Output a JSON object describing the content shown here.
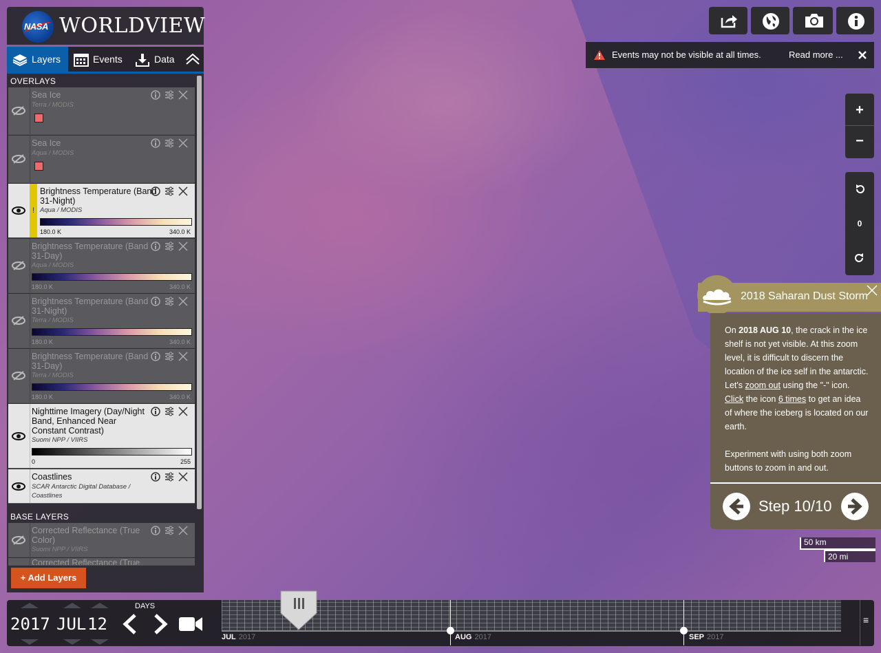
{
  "app": {
    "nasa": "NASA",
    "title": "WORLDVIEW"
  },
  "tabs": [
    {
      "label": "Layers",
      "icon": "layers-icon"
    },
    {
      "label": "Events",
      "icon": "calendar-icon"
    },
    {
      "label": "Data",
      "icon": "download-icon"
    }
  ],
  "sections": {
    "overlays": "OVERLAYS",
    "base_layers": "BASE LAYERS"
  },
  "layers": [
    {
      "name": "Sea Ice",
      "source": "Terra / MODIS",
      "visible": false,
      "legend": "swatch"
    },
    {
      "name": "Sea Ice",
      "source": "Aqua / MODIS",
      "visible": false,
      "legend": "swatch"
    },
    {
      "name": "Brightness Temperature (Band 31-Night)",
      "source": "Aqua / MODIS",
      "visible": true,
      "warning": "!",
      "min": "180.0 K",
      "max": "340.0 K"
    },
    {
      "name": "Brightness Temperature (Band 31-Day)",
      "source": "Aqua / MODIS",
      "visible": false,
      "min": "180.0 K",
      "max": "340.0 K"
    },
    {
      "name": "Brightness Temperature (Band 31-Night)",
      "source": "Terra / MODIS",
      "visible": false,
      "min": "180.0 K",
      "max": "340.0 K"
    },
    {
      "name": "Brightness Temperature (Band 31-Day)",
      "source": "Terra / MODIS",
      "visible": false,
      "min": "180.0 K",
      "max": "340.0 K"
    },
    {
      "name": "Nighttime Imagery (Day/Night Band, Enhanced Near Constant Contrast)",
      "source": "Suomi NPP / VIIRS",
      "visible": true,
      "min": "0",
      "max": "255"
    },
    {
      "name": "Coastlines",
      "source": "SCAR Antarctic Digital Database / Coastlines",
      "visible": true
    }
  ],
  "base_layers": [
    {
      "name": "Corrected Reflectance (True Color)",
      "source": "Suomi NPP / VIIRS",
      "visible": false
    },
    {
      "name": "Corrected Reflectance (True",
      "source": "",
      "visible": false
    }
  ],
  "add_layers": "+ Add Layers",
  "notice": {
    "text": "Events may not be visible at all times.",
    "link": "Read more ..."
  },
  "zoom": {
    "in": "+",
    "out": "−"
  },
  "rotation": {
    "value": "0"
  },
  "tour": {
    "title": "2018 Saharan Dust Storm",
    "p1_a": "On ",
    "p1_date": "2018 AUG 10",
    "p1_b": ", the crack in the ice shelf is not yet visible. At this zoom level, it is difficult to discern the location of the ice self in the antarctic. Let's ",
    "p1_link1": "zoom out",
    "p1_c": " using the \"-\" icon. ",
    "p1_link2": "Click",
    "p1_d": " the icon ",
    "p1_link3": "6 times",
    "p1_e": " to get an idea of where the iceberg is located on our earth.",
    "p2": "Experiment with using both zoom buttons to zoom in and out.",
    "step": "Step 10/10"
  },
  "scale": {
    "km": "50 km",
    "mi": "20 mi"
  },
  "timeline": {
    "year": "2017",
    "month": "JUL",
    "day": "12",
    "interval": "DAYS",
    "months": [
      {
        "label": "JUL",
        "year": "2017"
      },
      {
        "label": "AUG",
        "year": "2017"
      },
      {
        "label": "SEP",
        "year": "2017"
      }
    ],
    "menu": "≡"
  }
}
